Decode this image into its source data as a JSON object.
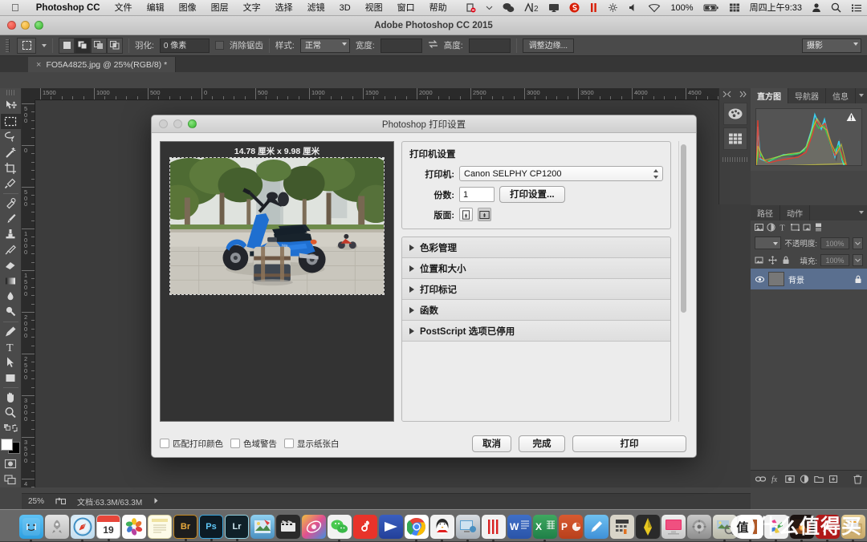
{
  "macbar": {
    "apple_icon": "apple-logo-icon",
    "app_name": "Photoshop CC",
    "menus": [
      "文件",
      "编辑",
      "图像",
      "图层",
      "文字",
      "选择",
      "滤镜",
      "3D",
      "视图",
      "窗口",
      "帮助"
    ],
    "status_icons": [
      "screenshot-icon",
      "chevron-down-icon",
      "wechat-icon",
      "input-method-icon",
      "airplay-icon",
      "sogou-icon",
      "pause-icon",
      "sync-icon",
      "volume-icon",
      "wifi-icon"
    ],
    "battery_percent": "100%",
    "battery_icon": "battery-charging-icon",
    "input_source_icon": "keyboard-grid-icon",
    "clock": "周四上午9:33",
    "user_icon": "user-icon",
    "search_icon": "search-icon",
    "notification_icon": "notification-list-icon"
  },
  "window": {
    "title": "Adobe Photoshop CC 2015"
  },
  "options_bar": {
    "tool_icon": "rectangular-marquee-icon",
    "selection_modes": [
      "new-selection",
      "add-to-selection",
      "subtract-from-selection",
      "intersect-selection"
    ],
    "active_selection_mode_index": 1,
    "feather_label": "羽化:",
    "feather_value": "0 像素",
    "antialias_label": "消除锯齿",
    "antialias_checked": false,
    "style_label": "样式:",
    "style_value": "正常",
    "width_label": "宽度:",
    "width_value": "",
    "swap_icon": "swap-dimensions-icon",
    "height_label": "高度:",
    "height_value": "",
    "refine_edge_label": "调整边缘...",
    "workspace_value": "摄影"
  },
  "document_tab": {
    "close_icon": "close-icon",
    "label": "FO5A4825.jpg @ 25%(RGB/8) *"
  },
  "toolbar": {
    "tools": [
      {
        "name": "move-tool",
        "selected": false
      },
      {
        "name": "rectangular-marquee-tool",
        "selected": true
      },
      {
        "name": "lasso-tool",
        "selected": false
      },
      {
        "name": "magic-wand-tool",
        "selected": false
      },
      {
        "name": "crop-tool",
        "selected": false
      },
      {
        "name": "eyedropper-tool",
        "selected": false
      },
      {
        "name": "healing-brush-tool",
        "selected": false
      },
      {
        "name": "brush-tool",
        "selected": false
      },
      {
        "name": "clone-stamp-tool",
        "selected": false
      },
      {
        "name": "history-brush-tool",
        "selected": false
      },
      {
        "name": "eraser-tool",
        "selected": false
      },
      {
        "name": "gradient-tool",
        "selected": false
      },
      {
        "name": "blur-tool",
        "selected": false
      },
      {
        "name": "dodge-tool",
        "selected": false
      },
      {
        "name": "pen-tool",
        "selected": false
      },
      {
        "name": "type-tool",
        "selected": false
      },
      {
        "name": "path-selection-tool",
        "selected": false
      },
      {
        "name": "rectangle-shape-tool",
        "selected": false
      },
      {
        "name": "hand-tool",
        "selected": false
      },
      {
        "name": "zoom-tool",
        "selected": false
      }
    ],
    "foreground_color": "#ffffff",
    "background_color": "#000000",
    "quick_mask_icon": "quick-mask-icon",
    "screen_mode_icon": "screen-mode-icon"
  },
  "rulers": {
    "horizontal_ticks": [
      "1500",
      "1000",
      "500",
      "0",
      "500",
      "1000",
      "1500",
      "2000",
      "2500",
      "3000",
      "3500",
      "4000",
      "4500"
    ],
    "vertical_ticks": [
      "500",
      "0",
      "500",
      "1000",
      "1500",
      "2000",
      "2500",
      "3000",
      "3500",
      "4000"
    ]
  },
  "mini_dock": {
    "collapse_icon": "collapse-icon",
    "expand_icon": "expand-icon",
    "items": [
      "color-palette-icon",
      "swatches-grid-icon"
    ]
  },
  "histogram_panel": {
    "tabs": [
      {
        "label": "直方图",
        "active": true
      },
      {
        "label": "导航器",
        "active": false
      },
      {
        "label": "信息",
        "active": false
      }
    ],
    "menu_icon": "panel-menu-icon",
    "warning_icon": "warning-icon"
  },
  "layers_panel": {
    "tabs": [
      {
        "label": "路径",
        "active": false
      },
      {
        "label": "动作",
        "active": false
      }
    ],
    "menu_icon": "panel-menu-icon",
    "blend_mode": "",
    "opacity_label": "不透明度:",
    "opacity_value": "100%",
    "fill_label": "填充:",
    "fill_value": "100%",
    "lock_icons": [
      "lock-pixels-icon",
      "lock-position-icon",
      "lock-all-icon"
    ],
    "layer": {
      "name": "背景",
      "locked": true,
      "lock_icon": "lock-icon"
    },
    "footer_icons": [
      "link-layers-icon",
      "layer-style-icon",
      "layer-mask-icon",
      "adjustment-layer-icon",
      "new-group-icon",
      "new-layer-icon",
      "delete-layer-icon"
    ]
  },
  "status_bar": {
    "zoom": "25%",
    "share_icon": "share-icon",
    "doc_info": "文档:63.3M/63.3M",
    "arrow_icon": "chevron-right-icon"
  },
  "print_dialog": {
    "title": "Photoshop 打印设置",
    "traffic_lights": [
      "close-button",
      "minimize-button",
      "maximize-button"
    ],
    "preview": {
      "size_label": "14.78 厘米 x 9.98 厘米",
      "image_description": "blue-scooter-with-backpack-on-tree-lined-street"
    },
    "printer_settings": {
      "legend": "打印机设置",
      "printer_label": "打印机:",
      "printer_value": "Canon SELPHY CP1200",
      "copies_label": "份数:",
      "copies_value": "1",
      "print_settings_button": "打印设置...",
      "layout_label": "版面:",
      "orientation_portrait_icon": "orientation-portrait-icon",
      "orientation_landscape_icon": "orientation-landscape-icon",
      "active_orientation": "landscape"
    },
    "sections": [
      {
        "label": "色彩管理",
        "expanded": false
      },
      {
        "label": "位置和大小",
        "expanded": false
      },
      {
        "label": "打印标记",
        "expanded": false
      },
      {
        "label": "函数",
        "expanded": false
      },
      {
        "label": "PostScript 选项已停用",
        "expanded": false
      }
    ],
    "checkboxes": [
      {
        "label": "匹配打印颜色",
        "checked": false
      },
      {
        "label": "色域警告",
        "checked": false
      },
      {
        "label": "显示纸张白",
        "checked": false
      }
    ],
    "buttons": {
      "cancel": "取消",
      "done": "完成",
      "print": "打印"
    }
  },
  "dock": {
    "items": [
      {
        "name": "finder",
        "running": true
      },
      {
        "name": "launchpad",
        "running": false
      },
      {
        "name": "safari",
        "running": true
      },
      {
        "name": "calendar",
        "running": true,
        "badge": "19"
      },
      {
        "name": "photos",
        "running": false
      },
      {
        "name": "notes",
        "running": false
      },
      {
        "name": "adobe-bridge",
        "running": true,
        "label": "Br"
      },
      {
        "name": "adobe-photoshop",
        "running": true,
        "label": "Ps"
      },
      {
        "name": "adobe-lightroom",
        "running": true,
        "label": "Lr"
      },
      {
        "name": "preview-app",
        "running": false
      },
      {
        "name": "final-cut-pro",
        "running": false
      },
      {
        "name": "photo-editor",
        "running": false
      },
      {
        "name": "wechat",
        "running": true
      },
      {
        "name": "netease-music",
        "running": false
      },
      {
        "name": "video-player",
        "running": false
      },
      {
        "name": "google-chrome",
        "running": true
      },
      {
        "name": "qq",
        "running": true
      },
      {
        "name": "remote-desktop",
        "running": true
      },
      {
        "name": "iina-player",
        "running": true
      },
      {
        "name": "microsoft-word",
        "running": false,
        "label": "W"
      },
      {
        "name": "microsoft-excel",
        "running": true,
        "label": "X"
      },
      {
        "name": "microsoft-powerpoint",
        "running": false,
        "label": "P"
      },
      {
        "name": "text-editor",
        "running": false
      },
      {
        "name": "calculator",
        "running": false
      },
      {
        "name": "sublime-text",
        "running": false
      },
      {
        "name": "imac-display",
        "running": false
      },
      {
        "name": "system-preferences",
        "running": false
      },
      {
        "name": "image-capture",
        "running": true
      },
      {
        "name": "microsoft-onenote",
        "running": true
      },
      {
        "name": "color-picker",
        "running": true
      },
      {
        "name": "fireplace-video",
        "running": true
      },
      {
        "name": "adobe-acrobat",
        "running": true
      },
      {
        "name": "folder-stack",
        "running": true
      }
    ]
  },
  "watermark": {
    "badge": "值",
    "text": "什么值得买"
  }
}
